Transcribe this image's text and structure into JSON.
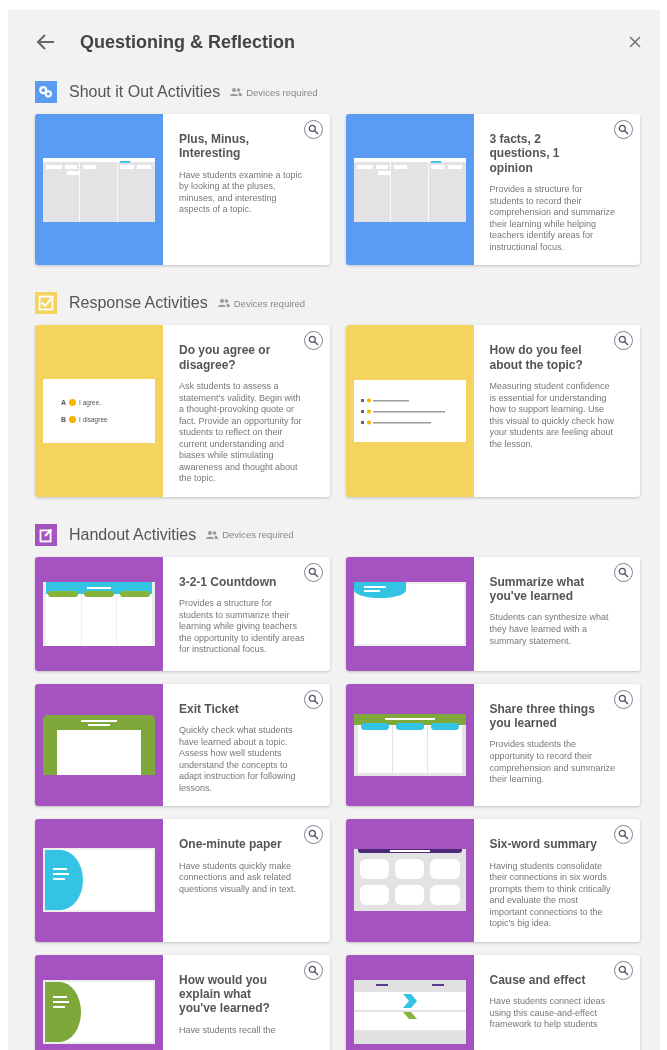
{
  "header": {
    "title": "Questioning & Reflection"
  },
  "sections": [
    {
      "title": "Shout it Out Activities",
      "kind": "shout",
      "color": "#5b9cf2",
      "note": "Devices required",
      "cards": [
        {
          "title": "Plus, Minus, Interesting",
          "description": "Have students examine a topic by looking at the pluses, minuses, and interesting aspects of a topic.",
          "preview": {
            "kind": "board"
          }
        },
        {
          "title": "3 facts, 2 questions, 1 opinion",
          "description": "Provides a structure for students to record their comprehension and summarize their learning while helping teachers identify areas for instructional focus.",
          "preview": {
            "kind": "board"
          }
        }
      ]
    },
    {
      "title": "Response Activities",
      "kind": "response",
      "color": "#f4d35e",
      "note": "Devices required",
      "cards": [
        {
          "title": "Do you agree or disagree?",
          "description": "Ask students to assess a statement's validity. Begin with a thought-provoking quote or fact. Provide an opportunity for students to reflect on their current understanding and biases while stimulating awareness and thought about the topic.",
          "preview": {
            "kind": "options",
            "texts": [
              "A",
              "I agree.",
              "B",
              "I disagree"
            ]
          }
        },
        {
          "title": "How do you feel about the topic?",
          "description": "Measuring student confidence is essential for understanding how to support learning. Use this visual to quickly check how your students are feeling about the lesson.",
          "preview": {
            "kind": "options_small"
          }
        }
      ]
    },
    {
      "title": "Handout Activities",
      "kind": "handout",
      "color": "#a553c1",
      "note": "Devices required",
      "cards": [
        {
          "title": "3-2-1 Countdown",
          "description": "Provides a structure for students to summarize their learning while giving teachers the opportunity to identify areas for instructional focus.",
          "preview": {
            "kind": "countdown"
          }
        },
        {
          "title": "Summarize what you've learned",
          "description": "Students can synthesize what they have learned with a summary statement.",
          "preview": {
            "kind": "bubble"
          }
        },
        {
          "title": "Exit Ticket",
          "description": "Quickly check what students have learned about a topic. Assess how well students understand the concepts to adapt instruction for following lessons.",
          "preview": {
            "kind": "ticket"
          }
        },
        {
          "title": "Share three things you learned",
          "description": "Provides students the opportunity to record their comprehension and summarize their learning.",
          "preview": {
            "kind": "share"
          }
        },
        {
          "title": "One-minute paper",
          "description": "Have students quickly make connections and ask related questions visually and in text.",
          "preview": {
            "kind": "paper"
          }
        },
        {
          "title": "Six-word summary",
          "description": "Having students consolidate their connections in six words prompts them to think critically and evaluate the most important connections to the topic's big idea.",
          "preview": {
            "kind": "tiles"
          }
        },
        {
          "title": "How would you explain what you've learned?",
          "description": "Have students recall the",
          "preview": {
            "kind": "paper_green"
          }
        },
        {
          "title": "Cause and effect",
          "description": "Have students connect ideas using this cause-and-effect framework to help students",
          "preview": {
            "kind": "cause"
          }
        }
      ]
    }
  ]
}
